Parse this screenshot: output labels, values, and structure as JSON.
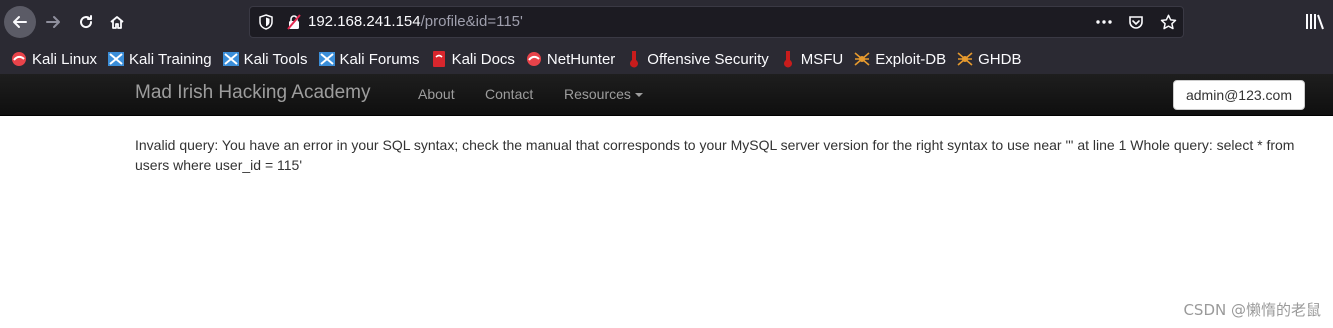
{
  "browser": {
    "url_host": "192.168.241.154",
    "url_path": "/profile&id=115'"
  },
  "bookmarks": [
    {
      "label": "Kali Linux",
      "icon": "kali-dragon-icon",
      "color": "#e8434a"
    },
    {
      "label": "Kali Training",
      "icon": "kali-training-icon",
      "color": "#3b8ed9"
    },
    {
      "label": "Kali Tools",
      "icon": "kali-tools-icon",
      "color": "#3b8ed9"
    },
    {
      "label": "Kali Forums",
      "icon": "kali-forums-icon",
      "color": "#3b8ed9"
    },
    {
      "label": "Kali Docs",
      "icon": "kali-docs-icon",
      "color": "#d8262d"
    },
    {
      "label": "NetHunter",
      "icon": "nethunter-icon",
      "color": "#e8434a"
    },
    {
      "label": "Offensive Security",
      "icon": "offsec-icon",
      "color": "#c81c1c"
    },
    {
      "label": "MSFU",
      "icon": "msfu-icon",
      "color": "#c81c1c"
    },
    {
      "label": "Exploit-DB",
      "icon": "exploit-db-icon",
      "color": "#e69a2e"
    },
    {
      "label": "GHDB",
      "icon": "ghdb-icon",
      "color": "#e69a2e"
    }
  ],
  "navbar": {
    "brand": "Mad Irish Hacking Academy",
    "links": [
      "About",
      "Contact",
      "Resources"
    ],
    "user": "admin@123.com"
  },
  "content": {
    "error": "Invalid query: You have an error in your SQL syntax; check the manual that corresponds to your MySQL server version for the right syntax to use near ''' at line 1 Whole query: select * from users where user_id = 115'"
  },
  "watermark": "CSDN @懒惰的老鼠"
}
